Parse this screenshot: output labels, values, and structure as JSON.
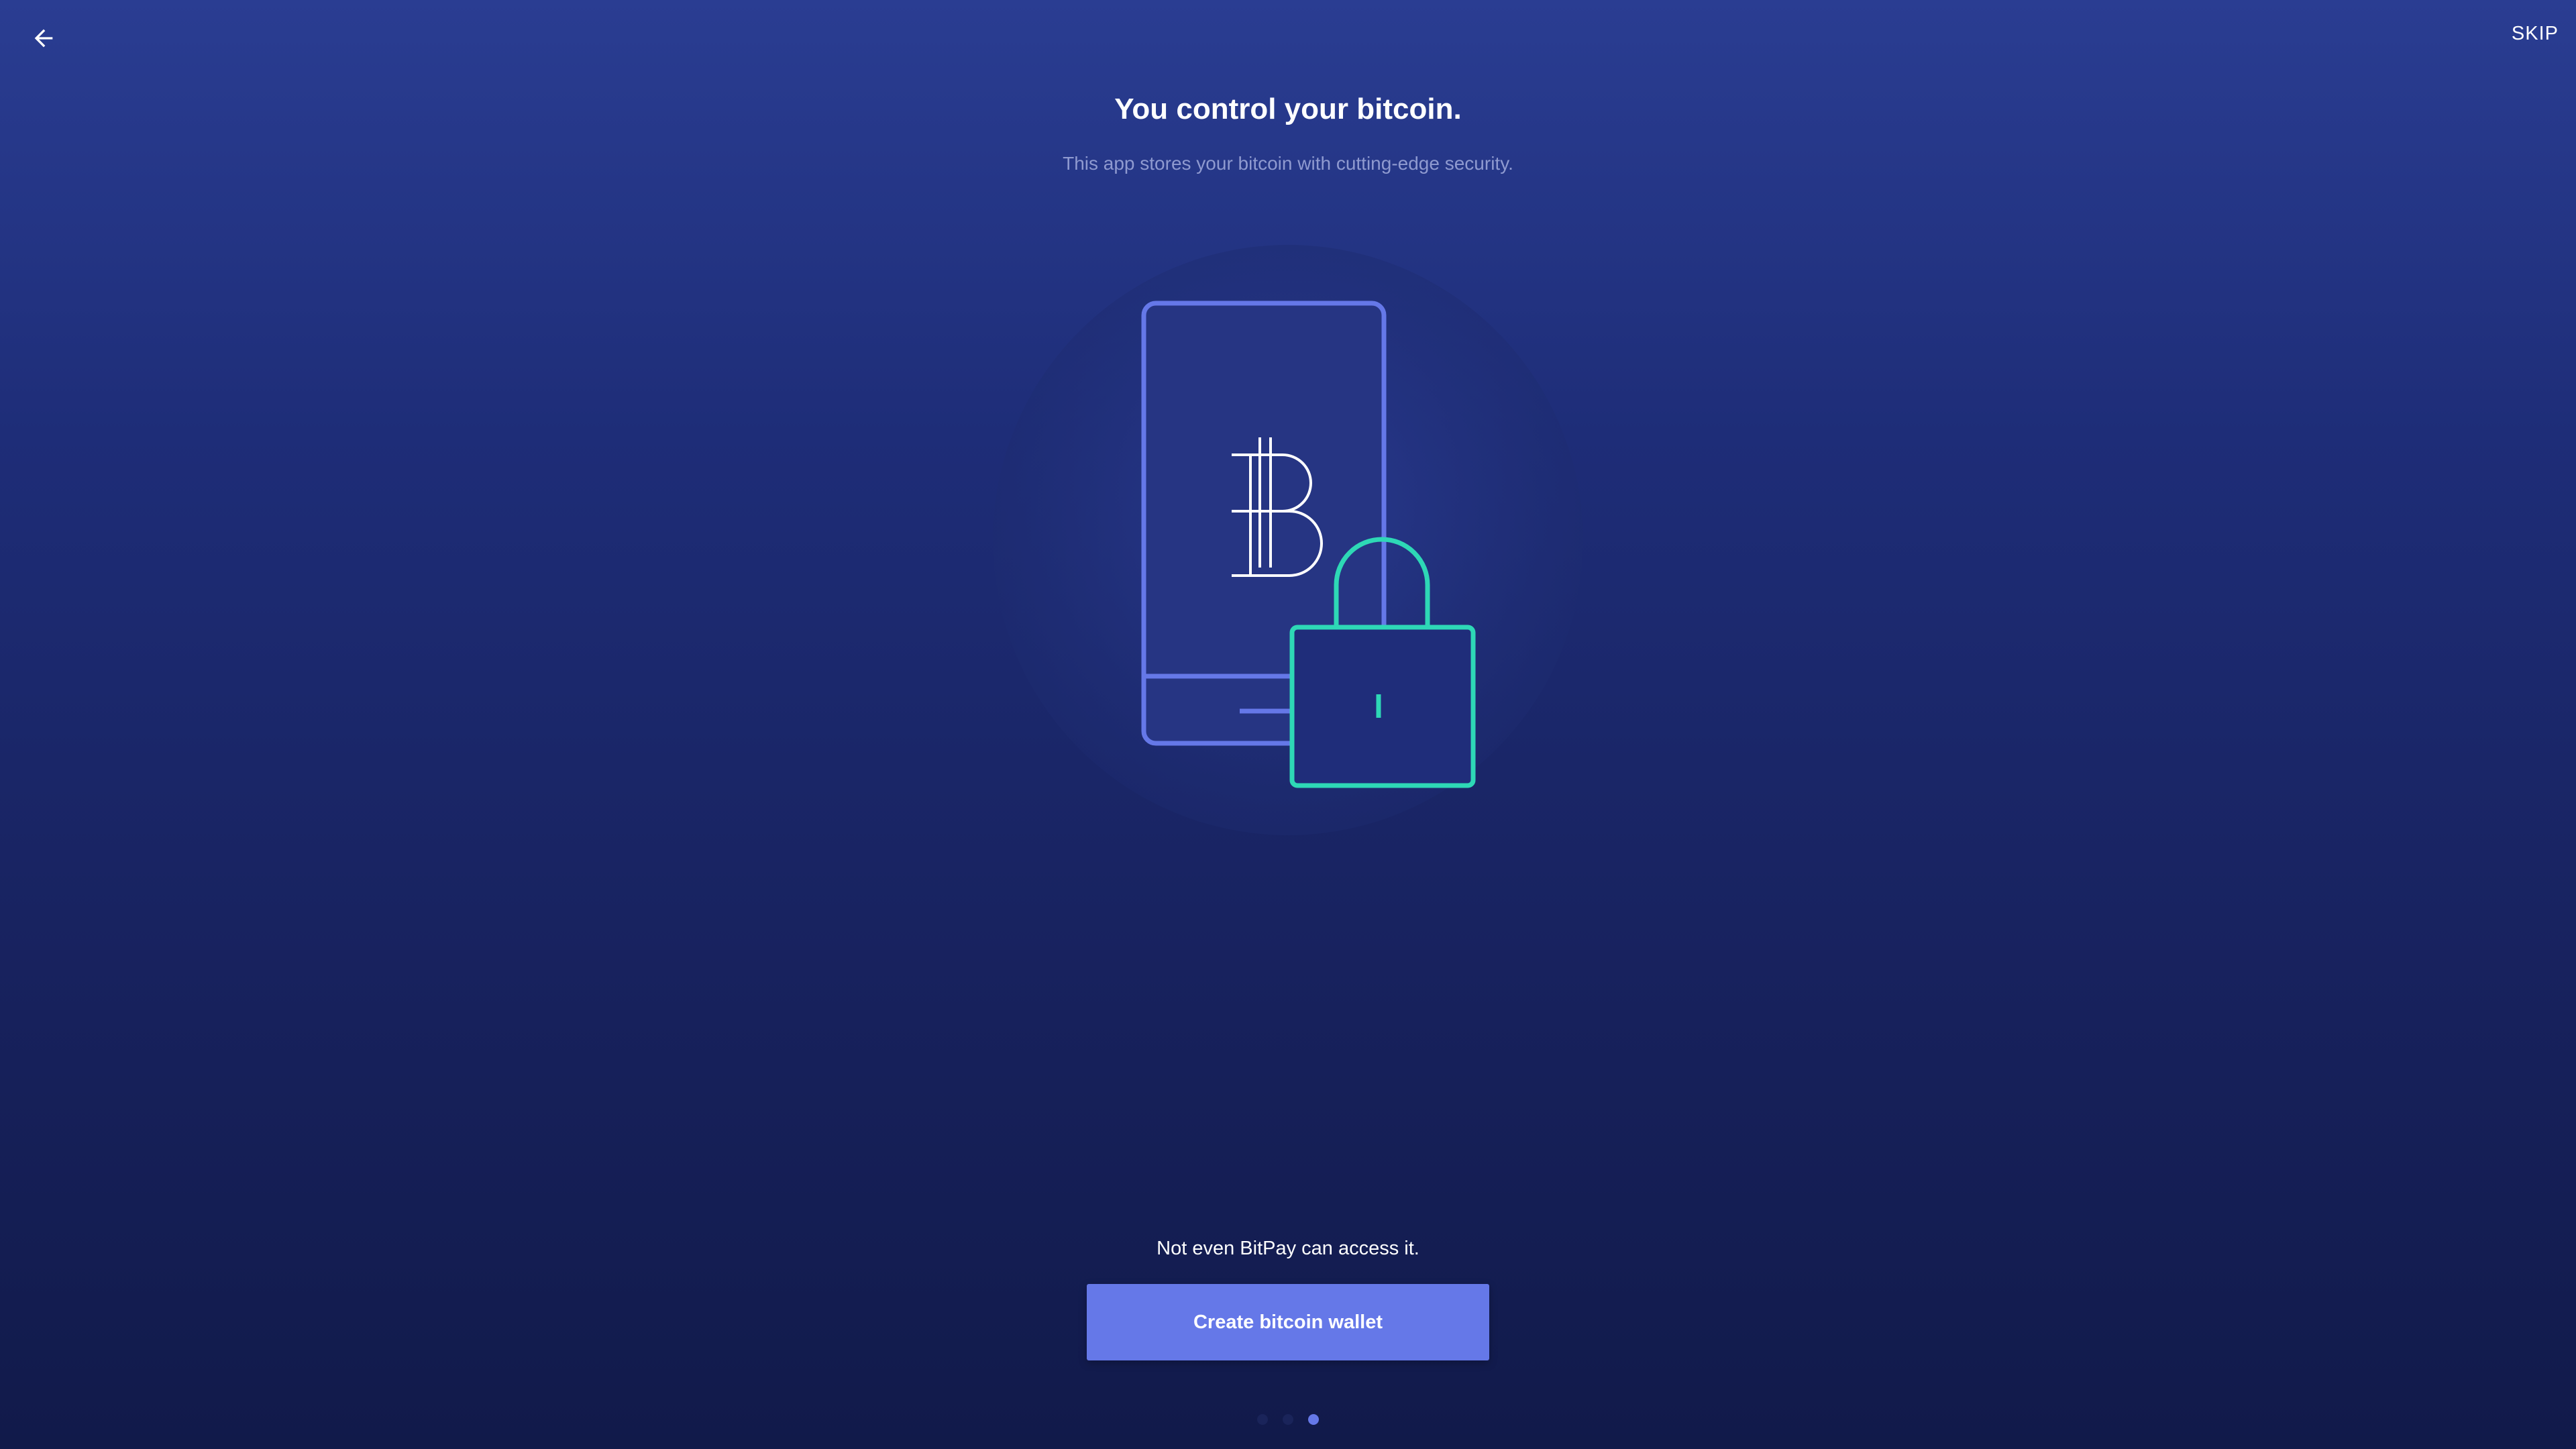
{
  "header": {
    "back_icon": "arrow-left-icon",
    "skip_label": "SKIP"
  },
  "onboarding": {
    "title": "You control your bitcoin.",
    "subtitle": "This app stores your bitcoin with cutting-edge security.",
    "illustration_icons": [
      "phone-icon",
      "bitcoin-icon",
      "padlock-icon"
    ],
    "note": "Not even BitPay can access it.",
    "cta_label": "Create bitcoin wallet"
  },
  "pagination": {
    "total": 3,
    "active_index": 2
  },
  "colors": {
    "accent": "#6578e8",
    "lock": "#2ed8b6",
    "phone": "#6578e8"
  }
}
